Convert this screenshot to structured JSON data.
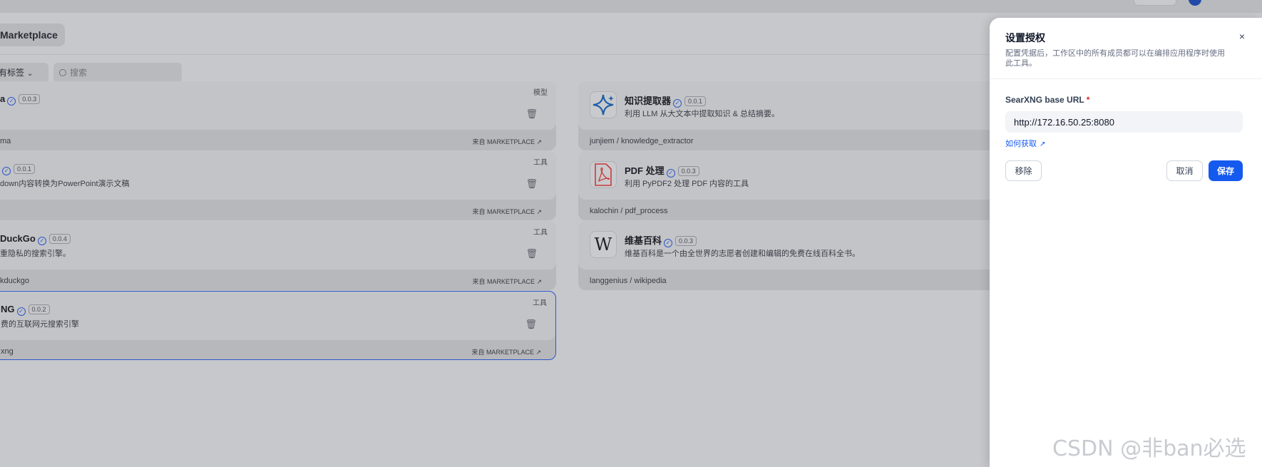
{
  "page": {
    "marketplace_tab": "Marketplace",
    "tag_filter": "所有标签",
    "search_placeholder": "搜索"
  },
  "cards": [
    {
      "kind": "模型",
      "title": "a",
      "version": "0.0.3",
      "desc": "",
      "footer": "ma",
      "source": "来自 MARKETPLACE ↗"
    },
    {
      "kind": "",
      "title": "知识提取器",
      "version": "0.0.1",
      "desc": "利用 LLM 从大文本中提取知识 & 总结摘要。",
      "footer": "junjiem / knowledge_extractor",
      "source": ""
    },
    {
      "kind": "工具",
      "title": "",
      "version": "0.0.1",
      "desc": "down内容转换为PowerPoint演示文稿",
      "footer": "",
      "source": "来自 MARKETPLACE ↗"
    },
    {
      "kind": "",
      "title": "PDF 处理",
      "version": "0.0.3",
      "desc": "利用 PyPDF2 处理 PDF 内容的工具",
      "footer": "kalochin / pdf_process",
      "source": ""
    },
    {
      "kind": "工具",
      "title": "DuckGo",
      "version": "0.0.4",
      "desc": "重隐私的搜索引擎。",
      "footer": "kduckgo",
      "source": "来自 MARKETPLACE ↗"
    },
    {
      "kind": "",
      "title": "维基百科",
      "version": "0.0.3",
      "desc": "维基百科是一个由全世界的志愿者创建和编辑的免费在线百科全书。",
      "footer": "langgenius / wikipedia",
      "source": ""
    },
    {
      "kind": "工具",
      "title": "NG",
      "version": "0.0.2",
      "desc": "费的互联网元搜索引擎",
      "footer": "xng",
      "source": "来自 MARKETPLACE ↗"
    }
  ],
  "drawer": {
    "title": "设置授权",
    "subtitle": "配置凭据后，工作区中的所有成员都可以在编排应用程序时使用此工具。",
    "field_label": "SearXNG base URL",
    "required_mark": "*",
    "url_value": "http://172.16.50.25:8080",
    "how_to_get": "如何获取",
    "remove_label": "移除",
    "cancel_label": "取消",
    "save_label": "保存",
    "close_glyph": "×"
  },
  "watermark": "CSDN @非ban必选",
  "colors": {
    "accent": "#155aef",
    "overlay_bg": "#c7c8cc",
    "selected_border": "#2d56c9"
  }
}
